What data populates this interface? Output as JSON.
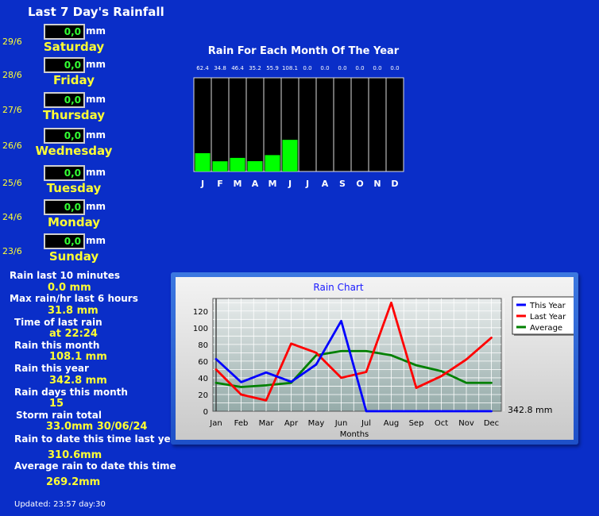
{
  "title": "Last 7 Day's Rainfall",
  "unit": "mm",
  "days": [
    {
      "date": "29/6",
      "value": "0,0",
      "name": "Saturday"
    },
    {
      "date": "28/6",
      "value": "0,0",
      "name": "Friday"
    },
    {
      "date": "27/6",
      "value": "0,0",
      "name": "Thursday"
    },
    {
      "date": "26/6",
      "value": "0,0",
      "name": "Wednesday"
    },
    {
      "date": "25/6",
      "value": "0,0",
      "name": "Tuesday"
    },
    {
      "date": "24/6",
      "value": "0,0",
      "name": "Monday"
    },
    {
      "date": "23/6",
      "value": "0,0",
      "name": "Sunday"
    }
  ],
  "stats": [
    {
      "label": "Rain last 10 minutes",
      "value": "0.0 mm"
    },
    {
      "label": "Max rain/hr last 6 hours",
      "value": "31.8 mm"
    },
    {
      "label": "Time of last rain",
      "value": "at 22:24"
    },
    {
      "label": "Rain this month",
      "value": "108.1 mm"
    },
    {
      "label": "Rain this year",
      "value": "342.8 mm"
    },
    {
      "label": "Rain days this month",
      "value": "15"
    },
    {
      "label": "Storm rain total",
      "value": "33.0mm 30/06/24"
    },
    {
      "label": "Rain to date this time last year",
      "value": "310.6mm"
    },
    {
      "label": "Average rain to date this time",
      "value": "269.2mm"
    }
  ],
  "updated": "Updated: 23:57 day:30",
  "chart_data": [
    {
      "type": "bar",
      "title": "Rain For Each Month Of The Year",
      "categories": [
        "J",
        "F",
        "M",
        "A",
        "M",
        "J",
        "J",
        "A",
        "S",
        "O",
        "N",
        "D"
      ],
      "values": [
        62.4,
        34.8,
        46.4,
        35.2,
        55.9,
        108.1,
        0.0,
        0.0,
        0.0,
        0.0,
        0.0,
        0.0
      ],
      "value_labels": [
        "62.4",
        "34.8",
        "46.4",
        "35.2",
        "55.9",
        "108.1",
        "0.0",
        "0.0",
        "0.0",
        "0.0",
        "0.0",
        "0.0"
      ],
      "ylim": [
        0,
        320
      ],
      "colors": {
        "bar": "#00ff00",
        "background": "#000000",
        "text": "#ffffff"
      }
    },
    {
      "type": "line",
      "title": "Rain Chart",
      "xlabel": "Months",
      "ylabel": "",
      "categories": [
        "Jan",
        "Feb",
        "Mar",
        "Apr",
        "May",
        "Jun",
        "Jul",
        "Aug",
        "Sep",
        "Oct",
        "Nov",
        "Dec"
      ],
      "ylim": [
        0,
        135
      ],
      "yticks": [
        0,
        20,
        40,
        60,
        80,
        100,
        120
      ],
      "grid": true,
      "legend": "top-right",
      "total_label": "342.8 mm",
      "series": [
        {
          "name": "This Year",
          "color": "#0000ff",
          "values": [
            62.4,
            34.8,
            46.4,
            35.2,
            55.9,
            108.1,
            0,
            0,
            0,
            0,
            0,
            0
          ]
        },
        {
          "name": "Last Year",
          "color": "#ff0000",
          "values": [
            50,
            20,
            13,
            81,
            70,
            40,
            47,
            130,
            28,
            42,
            62,
            88
          ]
        },
        {
          "name": "Average",
          "color": "#008000",
          "values": [
            34,
            29,
            31,
            34,
            67,
            72,
            72,
            67,
            55,
            48,
            34,
            34
          ]
        }
      ]
    }
  ]
}
